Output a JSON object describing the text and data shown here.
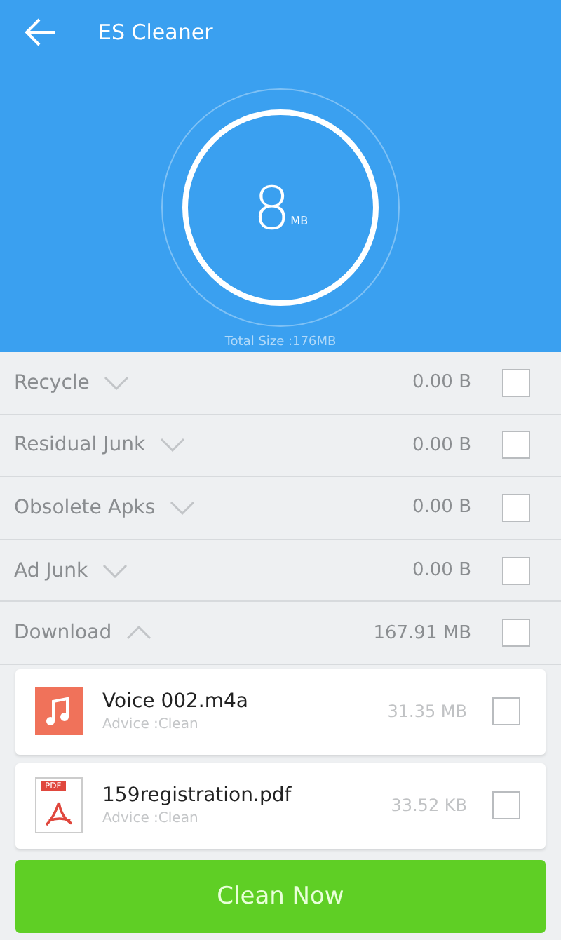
{
  "app_bar": {
    "title": "ES Cleaner"
  },
  "summary": {
    "amount": "8",
    "unit": "MB",
    "total": "Total Size :176MB"
  },
  "categories": [
    {
      "name": "Recycle",
      "size": "0.00 B",
      "expanded": false,
      "checked": false
    },
    {
      "name": "Residual Junk",
      "size": "0.00 B",
      "expanded": false,
      "checked": false
    },
    {
      "name": "Obsolete Apks",
      "size": "0.00 B",
      "expanded": false,
      "checked": false
    },
    {
      "name": "Ad Junk",
      "size": "0.00 B",
      "expanded": false,
      "checked": false
    },
    {
      "name": "Download",
      "size": "167.91 MB",
      "expanded": true,
      "checked": false
    }
  ],
  "files": [
    {
      "kind": "audio",
      "name": "Voice 002.m4a",
      "advice": "Advice :Clean",
      "size": "31.35 MB",
      "checked": false
    },
    {
      "kind": "pdf",
      "badge": "PDF",
      "name": "159registration.pdf",
      "advice": "Advice :Clean",
      "size": "33.52 KB",
      "checked": false
    }
  ],
  "action_button": "Clean Now"
}
